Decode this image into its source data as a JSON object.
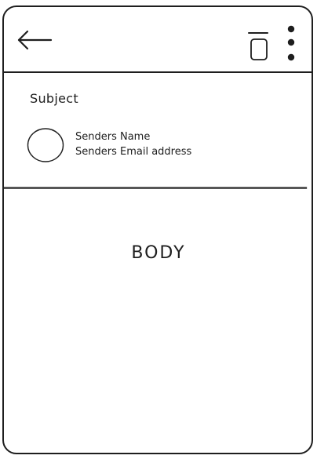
{
  "toolbar": {
    "back_icon": "arrow-left-icon",
    "delete_icon": "trash-icon",
    "menu_icon": "more-vertical-icon"
  },
  "email": {
    "subject": "Subject",
    "sender_name": "Senders Name",
    "sender_email": "Senders Email address",
    "avatar_icon": "avatar-circle",
    "body": "BODY"
  },
  "colors": {
    "stroke": "#1e1e1e",
    "background": "#ffffff"
  }
}
